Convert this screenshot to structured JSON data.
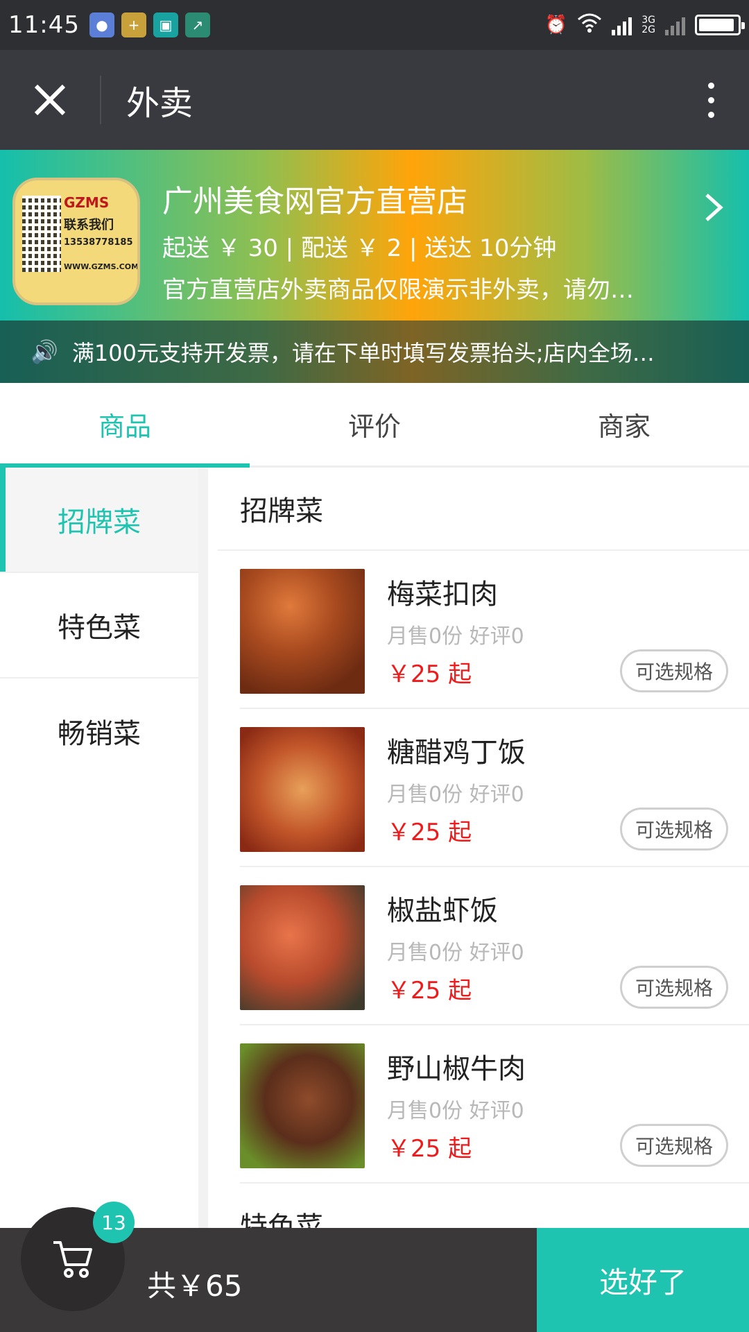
{
  "status_bar": {
    "time": "11:45",
    "apps": [
      "wechat-icon",
      "plus-app-icon",
      "scan-app-icon",
      "chart-app-icon"
    ],
    "network_top": "3G",
    "network_bottom": "2G"
  },
  "title_bar": {
    "title": "外卖",
    "close_icon": "close-icon",
    "more_icon": "more-vertical-icon"
  },
  "shop": {
    "logo": {
      "brand": "GZMS",
      "line1": "联系我们",
      "line2": "13538778185",
      "line3": "WWW.GZMS.COM"
    },
    "name": "广州美食网官方直营店",
    "meta": "起送 ￥ 30 | 配送 ￥ 2 | 送达 10分钟",
    "description": "官方直营店外卖商品仅限演示非外卖，请勿…"
  },
  "notice": {
    "text": "满100元支持开发票，请在下单时填写发票抬头;店内全场…"
  },
  "tabs": [
    {
      "label": "商品",
      "active": true
    },
    {
      "label": "评价",
      "active": false
    },
    {
      "label": "商家",
      "active": false
    }
  ],
  "categories": [
    {
      "label": "招牌菜",
      "active": true
    },
    {
      "label": "特色菜",
      "active": false
    },
    {
      "label": "畅销菜",
      "active": false
    }
  ],
  "section": {
    "title": "招牌菜",
    "next_title": "特色菜"
  },
  "items": [
    {
      "name": "梅菜扣肉",
      "stats": "月售0份 好评0",
      "price": "￥25 起",
      "spec": "可选规格"
    },
    {
      "name": "糖醋鸡丁饭",
      "stats": "月售0份 好评0",
      "price": "￥25 起",
      "spec": "可选规格"
    },
    {
      "name": "椒盐虾饭",
      "stats": "月售0份 好评0",
      "price": "￥25 起",
      "spec": "可选规格"
    },
    {
      "name": "野山椒牛肉",
      "stats": "月售0份 好评0",
      "price": "￥25 起",
      "spec": "可选规格"
    }
  ],
  "cart": {
    "count": "13",
    "total": "共￥65",
    "confirm_label": "选好了"
  },
  "colors": {
    "accent": "#1ec4b0",
    "price": "#f01a1a",
    "title_bar": "#393a3f",
    "bottom_bar": "#3a3838"
  }
}
